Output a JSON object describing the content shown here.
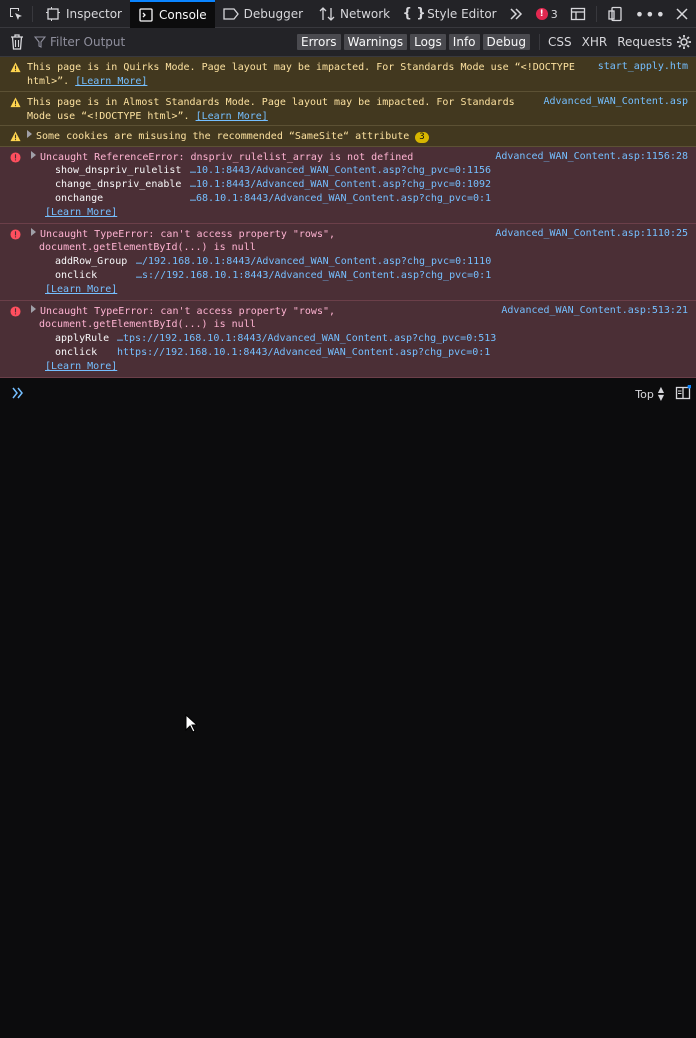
{
  "toolbar": {
    "tabs": [
      {
        "label": "Inspector",
        "icon": "inspector-icon"
      },
      {
        "label": "Console",
        "icon": "console-icon"
      },
      {
        "label": "Debugger",
        "icon": "debugger-icon"
      },
      {
        "label": "Network",
        "icon": "network-icon"
      },
      {
        "label": "Style Editor",
        "icon": "style-editor-icon"
      }
    ],
    "error_count": "3"
  },
  "filter": {
    "placeholder": "Filter Output",
    "buttons": [
      "Errors",
      "Warnings",
      "Logs",
      "Info",
      "Debug"
    ],
    "texts": [
      "CSS",
      "XHR",
      "Requests"
    ]
  },
  "messages": {
    "m1": {
      "line1": "This page is in Quirks Mode. Page layout may be impacted. For Standards Mode use “<!DOCTYPE",
      "line2": "html>”. ",
      "learn": "[Learn More]",
      "loc": "start_apply.htm"
    },
    "m2": {
      "line1": "This page is in Almost Standards Mode. Page layout may be impacted. For Standards",
      "line2": "Mode use “<!DOCTYPE html>”. ",
      "learn": "[Learn More]",
      "loc": "Advanced_WAN_Content.asp"
    },
    "m3": {
      "text": "Some cookies are misusing the recommended “SameSite“ attribute",
      "count": "3"
    },
    "m4": {
      "text": "Uncaught ReferenceError: dnspriv_rulelist_array is not defined",
      "loc": "Advanced_WAN_Content.asp:1156:28",
      "trace": [
        {
          "fn": "show_dnspriv_rulelist",
          "loc": "…10.1:8443/Advanced_WAN_Content.asp?chg_pvc=0:1156"
        },
        {
          "fn": "change_dnspriv_enable",
          "loc": "…10.1:8443/Advanced_WAN_Content.asp?chg_pvc=0:1092"
        },
        {
          "fn": "onchange",
          "loc": "…68.10.1:8443/Advanced_WAN_Content.asp?chg_pvc=0:1"
        }
      ],
      "learn": "[Learn More]"
    },
    "m5": {
      "line1": "Uncaught TypeError: can't access property \"rows\",",
      "line2": "document.getElementById(...) is null",
      "loc": "Advanced_WAN_Content.asp:1110:25",
      "trace": [
        {
          "fn": "addRow_Group",
          "loc": "…/192.168.10.1:8443/Advanced_WAN_Content.asp?chg_pvc=0:1110"
        },
        {
          "fn": "onclick",
          "loc": "…s://192.168.10.1:8443/Advanced_WAN_Content.asp?chg_pvc=0:1"
        }
      ],
      "learn": "[Learn More]"
    },
    "m6": {
      "line1": "Uncaught TypeError: can't access property \"rows\",",
      "line2": "document.getElementById(...) is null",
      "loc": "Advanced_WAN_Content.asp:513:21",
      "trace": [
        {
          "fn": "applyRule",
          "loc": "…tps://192.168.10.1:8443/Advanced_WAN_Content.asp?chg_pvc=0:513"
        },
        {
          "fn": "onclick",
          "loc": "https://192.168.10.1:8443/Advanced_WAN_Content.asp?chg_pvc=0:1"
        }
      ],
      "learn": "[Learn More]"
    }
  },
  "prompt": {
    "context": "Top"
  }
}
